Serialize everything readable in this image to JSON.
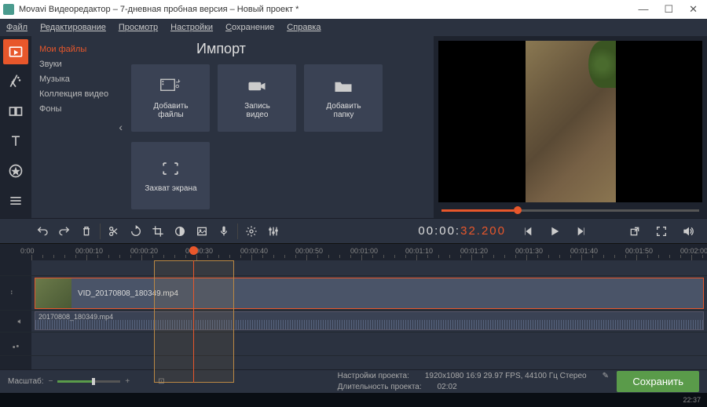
{
  "window": {
    "title": "Movavi Видеоредактор – 7-дневная пробная версия – Новый проект *"
  },
  "menu": {
    "file": "Файл",
    "edit": "Редактирование",
    "view": "Просмотр",
    "settings": "Настройки",
    "save": "Сохранение",
    "help": "Справка"
  },
  "import": {
    "title": "Импорт",
    "categories": {
      "myfiles": "Мои файлы",
      "sounds": "Звуки",
      "music": "Музыка",
      "videocol": "Коллекция видео",
      "backgrounds": "Фоны"
    },
    "tiles": {
      "add_files": "Добавить\nфайлы",
      "record_video": "Запись\nвидео",
      "add_folder": "Добавить\nпапку",
      "screen_capture": "Захват экрана"
    }
  },
  "playback": {
    "timecode_white": "00:00:",
    "timecode_orange": "32.200"
  },
  "timeline": {
    "labels": [
      "0:00",
      "00:00:10",
      "00:00:20",
      "00:00:30",
      "00:00:40",
      "00:00:50",
      "00:01:00",
      "00:01:10",
      "00:01:20",
      "00:01:30",
      "00:01:40",
      "00:01:50",
      "00:02:00"
    ],
    "video_clip": "VID_20170808_180349.mp4",
    "audio_clip": "20170808_180349.mp4"
  },
  "footer": {
    "zoom_label": "Масштаб:",
    "proj_settings_label": "Настройки проекта:",
    "proj_settings_value": "1920x1080 16:9 29.97 FPS, 44100 Гц Стерео",
    "duration_label": "Длительность проекта:",
    "duration_value": "02:02",
    "save": "Сохранить"
  },
  "taskbar": {
    "clock": "22:37"
  }
}
